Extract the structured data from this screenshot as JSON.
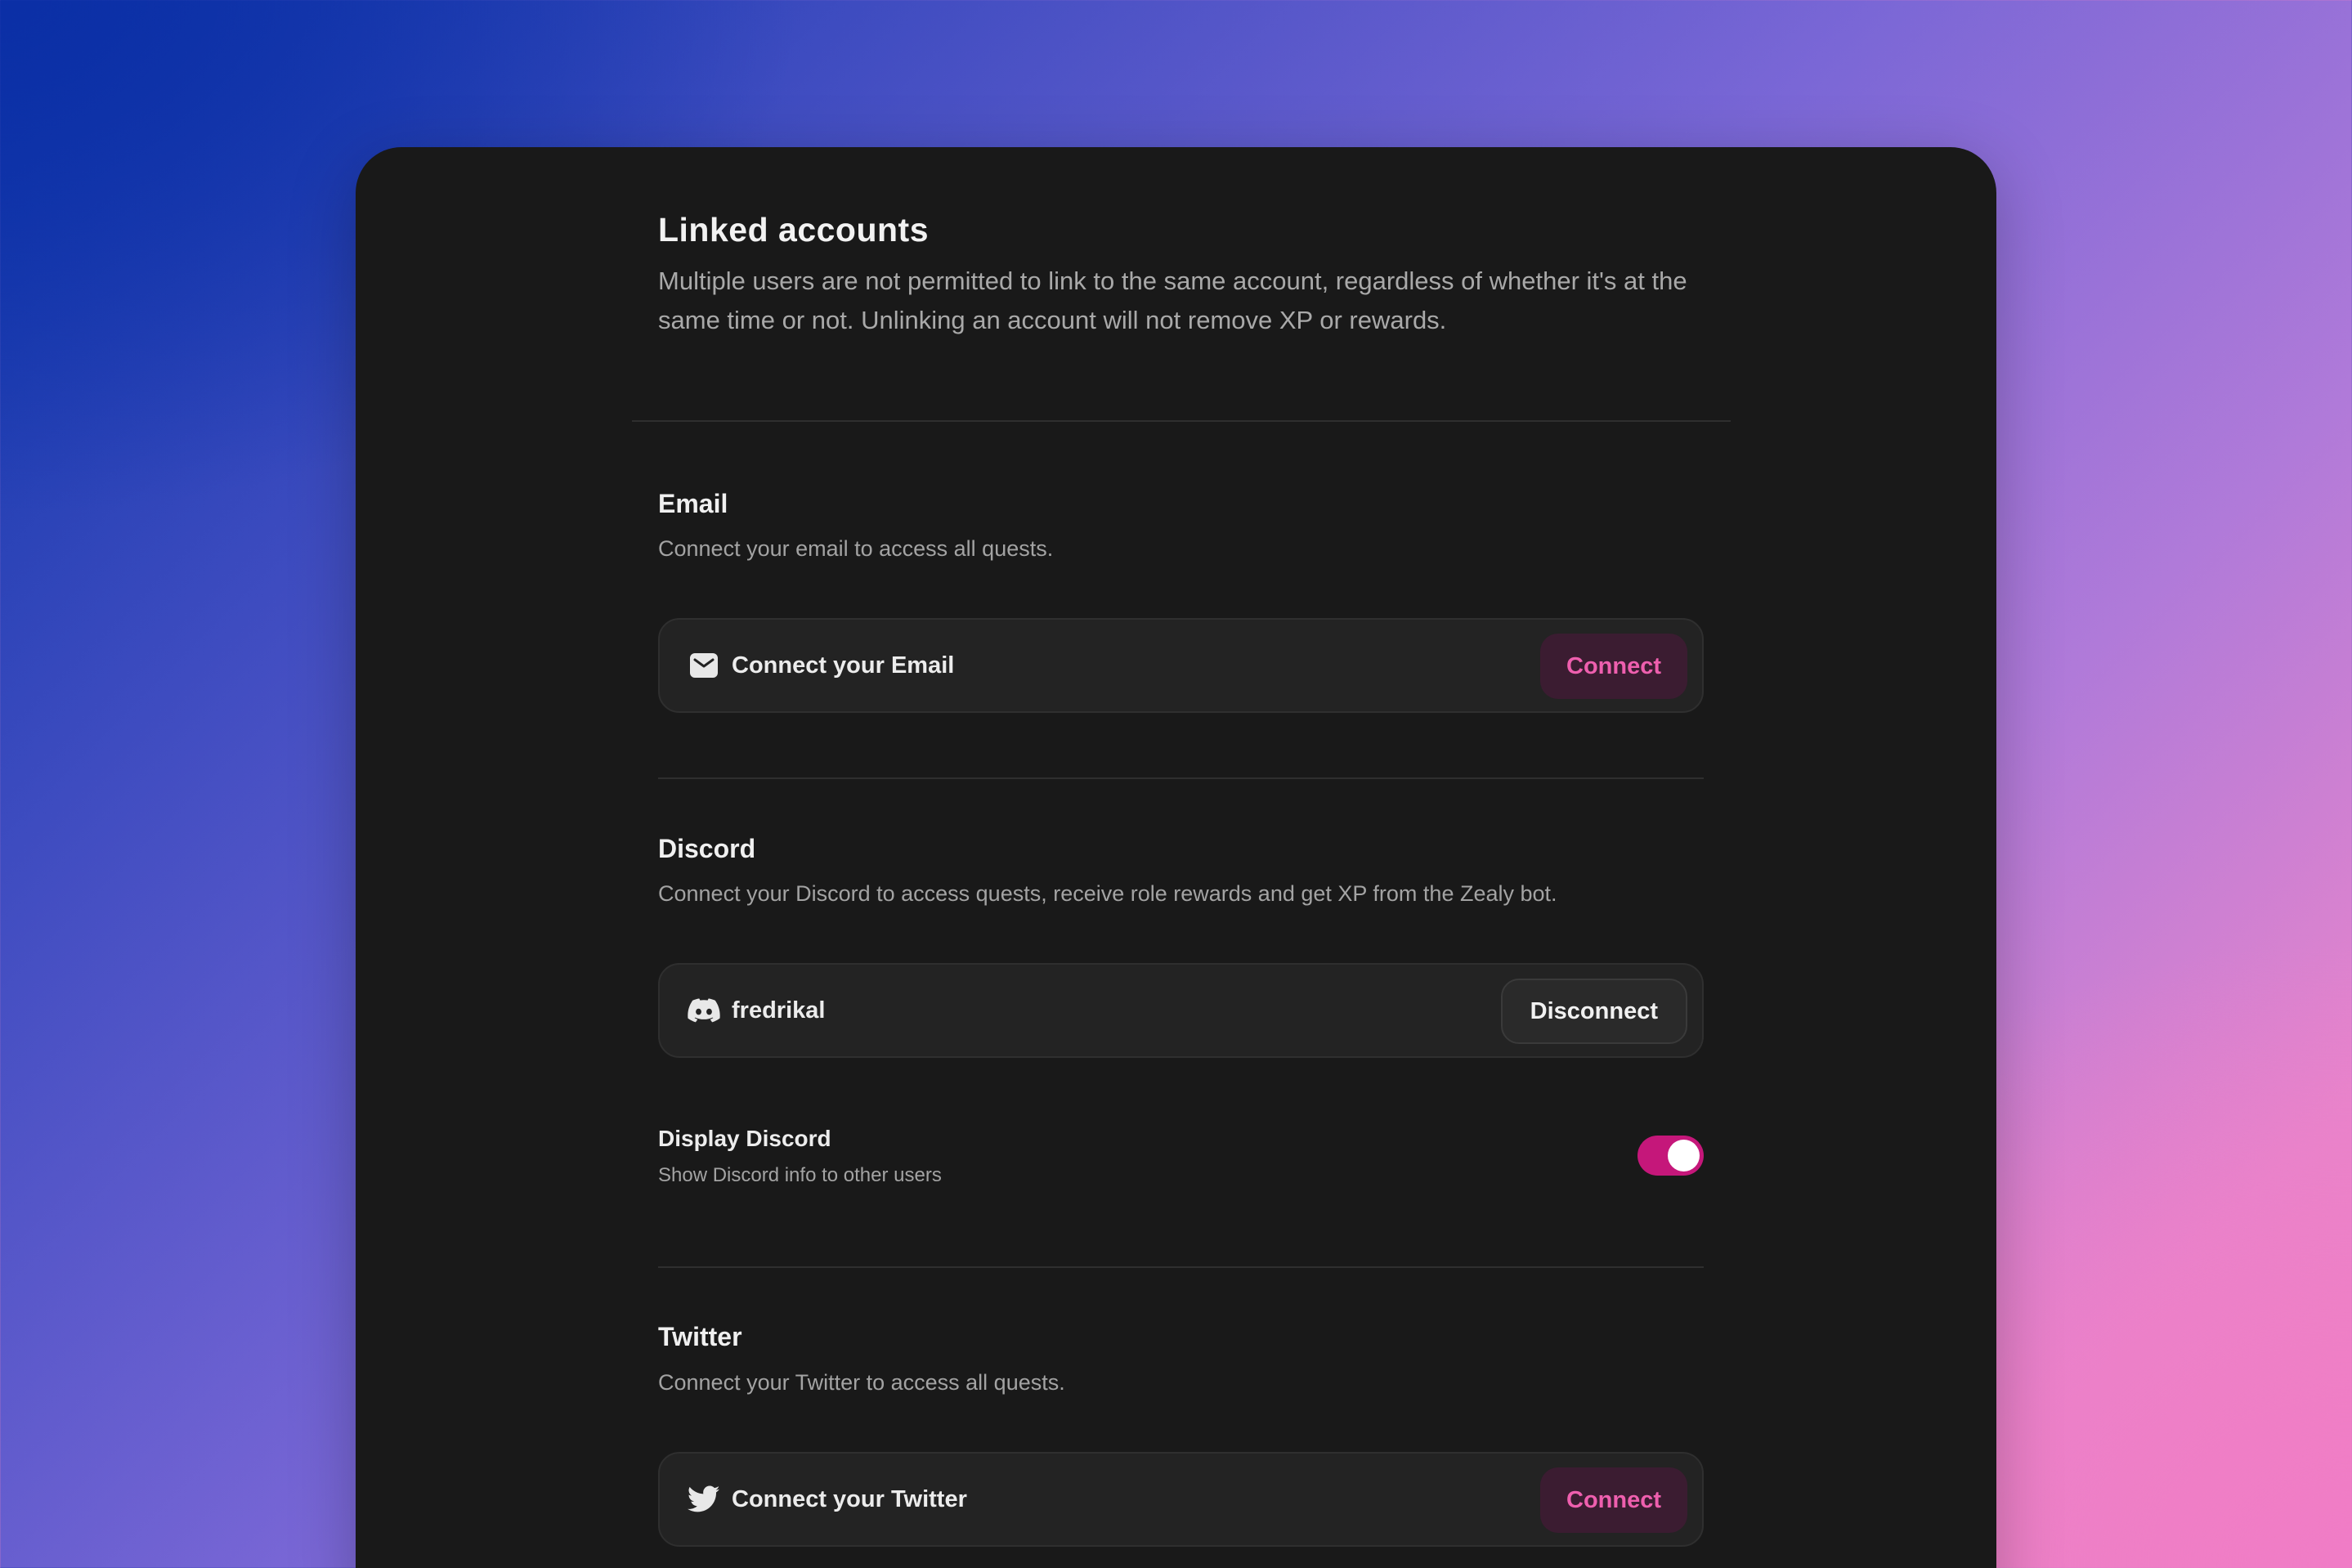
{
  "page": {
    "title": "Linked accounts",
    "description": "Multiple users are not permitted to link to the same account, regardless of whether it's at the same time or not. Unlinking an account will not remove XP or rewards."
  },
  "email": {
    "title": "Email",
    "description": "Connect your email to access all quests.",
    "row_label": "Connect your Email",
    "button_label": "Connect",
    "icon": "mail-icon"
  },
  "discord": {
    "title": "Discord",
    "description": "Connect your Discord to access quests, receive role rewards and get XP from the Zealy bot.",
    "username": "fredrikal",
    "button_label": "Disconnect",
    "icon": "discord-icon",
    "display_option": {
      "title": "Display Discord",
      "description": "Show Discord info to other users",
      "enabled": true
    }
  },
  "twitter": {
    "title": "Twitter",
    "description": "Connect your Twitter to access all quests.",
    "row_label": "Connect your Twitter",
    "button_label": "Connect",
    "icon": "twitter-icon"
  },
  "colors": {
    "accent": "#c5177a",
    "connect_text": "#ee5fae",
    "card": "#191919"
  }
}
